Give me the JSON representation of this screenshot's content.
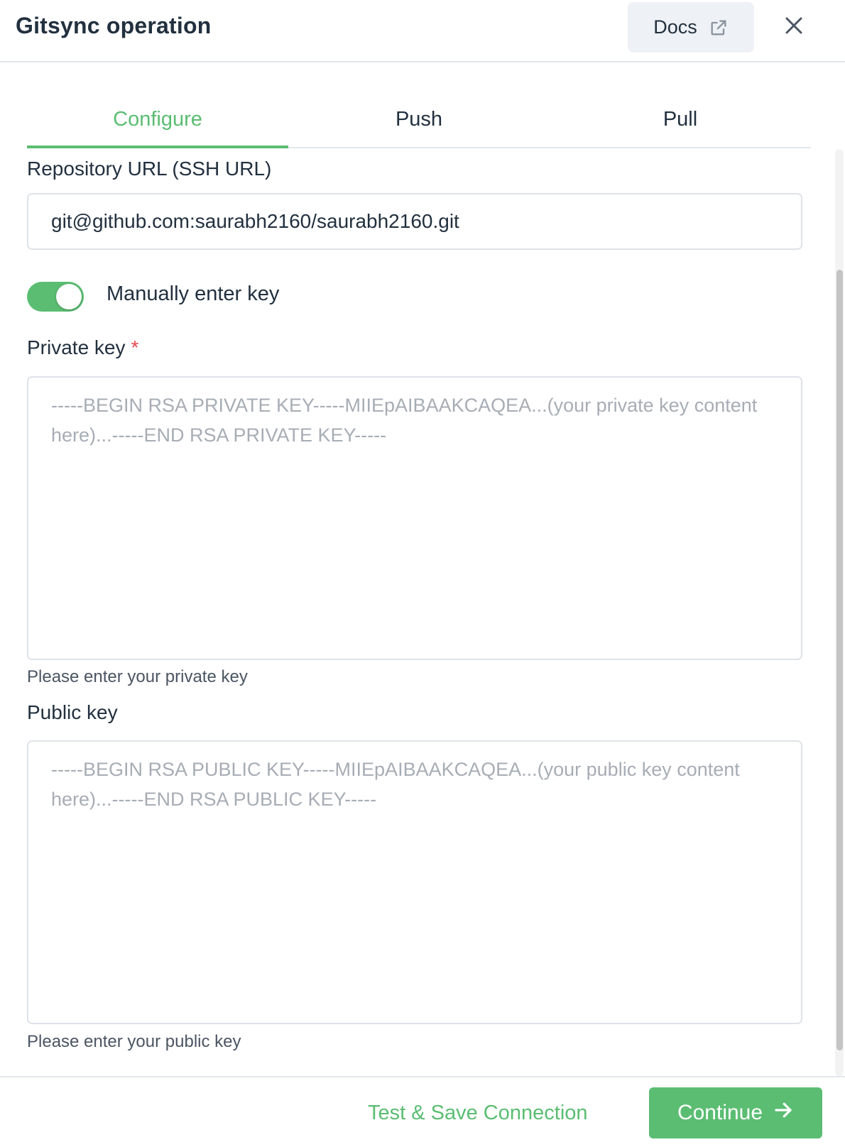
{
  "header": {
    "title": "Gitsync operation",
    "docs_label": "Docs"
  },
  "tabs": [
    {
      "label": "Configure",
      "active": true
    },
    {
      "label": "Push",
      "active": false
    },
    {
      "label": "Pull",
      "active": false
    }
  ],
  "form": {
    "repo_url_label": "Repository URL (SSH URL)",
    "repo_url_value": "git@github.com:saurabh2160/saurabh2160.git",
    "toggle_label": "Manually enter key",
    "toggle_on": true,
    "private_key_label": "Private key",
    "required_marker": "*",
    "private_key_placeholder": "-----BEGIN RSA PRIVATE KEY-----MIIEpAIBAAKCAQEA...(your private key content here)...-----END RSA PRIVATE KEY-----",
    "private_key_helper": "Please enter your private key",
    "public_key_label": "Public key",
    "public_key_placeholder": "-----BEGIN RSA PUBLIC KEY-----MIIEpAIBAAKCAQEA...(your public key content here)...-----END RSA PUBLIC KEY-----",
    "public_key_helper": "Please enter your public key"
  },
  "footer": {
    "test_save_label": "Test & Save Connection",
    "continue_label": "Continue"
  },
  "colors": {
    "accent": "#5bbd72",
    "required": "#e5484d",
    "text": "#22303f",
    "placeholder": "#a7adb5"
  },
  "icons": {
    "docs": "external-link-icon",
    "close": "close-icon",
    "continue": "arrow-right-icon"
  }
}
